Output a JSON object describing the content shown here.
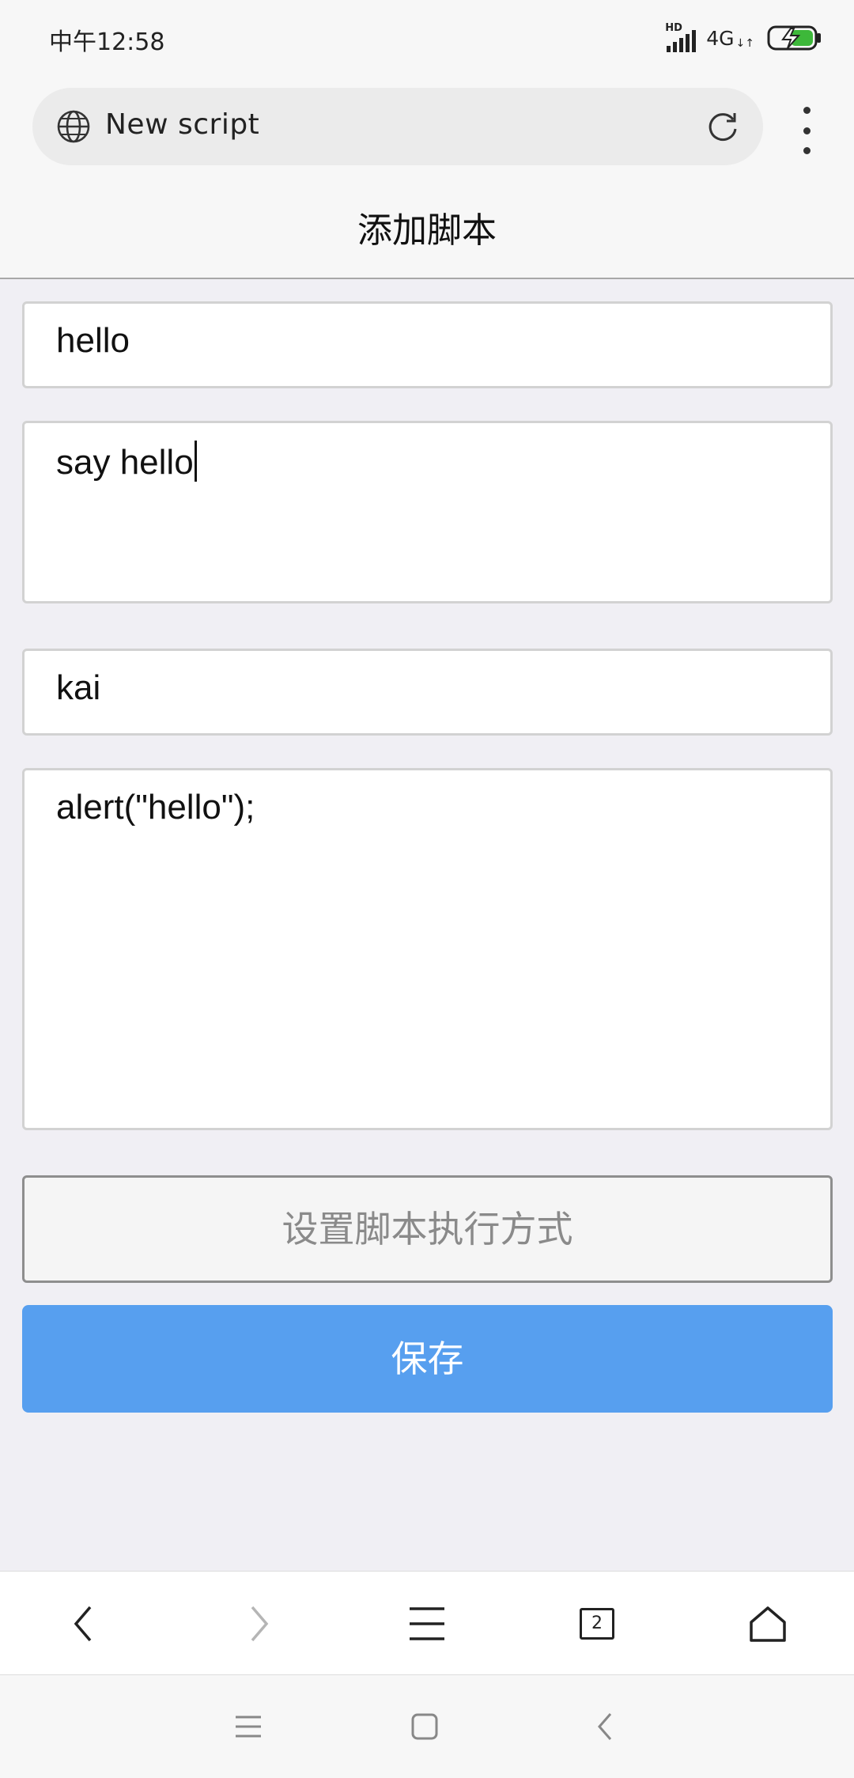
{
  "status_bar": {
    "time": "中午12:58",
    "hd_label": "HD",
    "network": "4G",
    "network_arrows": "↓↑"
  },
  "browser": {
    "url_text": "New script",
    "tabs_count": "2"
  },
  "page": {
    "title": "添加脚本"
  },
  "form": {
    "name_value": "hello",
    "description_value": "say hello",
    "author_value": "kai",
    "code_value": "alert(\"hello\");",
    "exec_mode_label": "设置脚本执行方式",
    "save_label": "保存"
  },
  "colors": {
    "save_button_bg": "#579fef",
    "page_bg": "#f0eff4",
    "battery_fill": "#3db83a"
  }
}
